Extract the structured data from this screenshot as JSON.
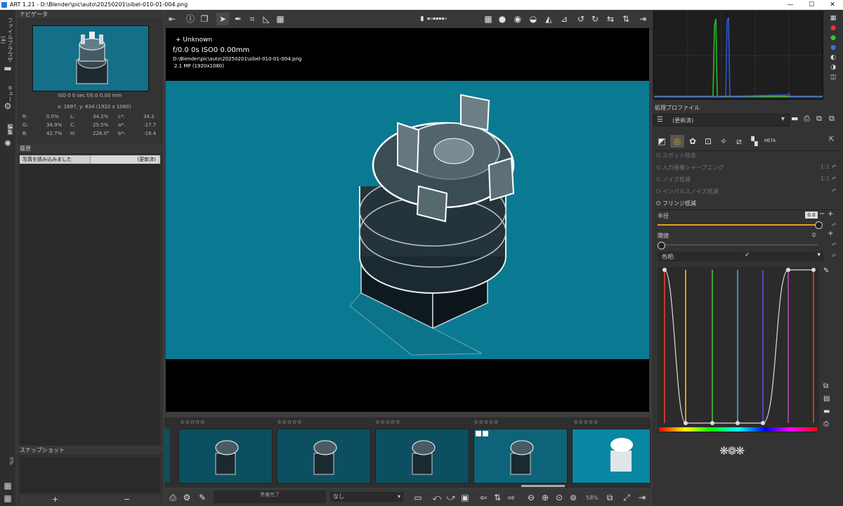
{
  "window": {
    "title": "ART 1.21 - D:\\Blender\\pic\\auto\\20250201\\sibel-010-01-004.png",
    "minimize": "—",
    "maximize": "☐",
    "close": "✕"
  },
  "vertical_tabs": {
    "file_browser": "ファイルブラウザ (4)",
    "queue": "キュー",
    "edit": "編集"
  },
  "navigator": {
    "header": "ナビゲータ",
    "exif": "ISO 0    0 sec    f/0.0    0.00 mm",
    "coords": "x: 1697, y: 634    (1920 x 1080)",
    "rows": [
      {
        "l1": "R:",
        "v1": "0.0%",
        "l2": "L:",
        "v2": "34.2%",
        "l3": "L*:",
        "v3": "34.2"
      },
      {
        "l1": "G:",
        "v1": "34.9%",
        "l2": "C:",
        "v2": "25.5%",
        "l3": "a*:",
        "v3": "-17.7"
      },
      {
        "l1": "B:",
        "v1": "42.7%",
        "l2": "H:",
        "v2": "226.0°",
        "l3": "b*:",
        "v3": "-18.4"
      }
    ]
  },
  "history": {
    "header": "履歴",
    "item_label": "写真を読み込みました",
    "item_status": "(更新済)"
  },
  "snapshot": {
    "header": "スナップショット",
    "add": "+",
    "remove": "−"
  },
  "overlay": {
    "camera": "+ Unknown",
    "exposure": "f/0.0   0s   ISO0   0.00mm",
    "path": "D:\\Blender\\pic\\auto\\20250201\\sibel-010-01-004.png",
    "megapixels": "2.1 MP (1920x1080)"
  },
  "filmstrip": {
    "stars": "☆☆☆☆☆"
  },
  "bottom": {
    "status": "準備完了",
    "select_value": "なし",
    "zoom": "58%"
  },
  "profile": {
    "header": "処理プロファイル",
    "value": "(更新済)"
  },
  "tools": {
    "spot_removal": "スポット除去",
    "input_sharpening": "入力画像シャープニング",
    "noise_reduction": "ノイズ低減",
    "impulse_noise": "インパルスノイズ低減",
    "fringe": "フリンジ低減",
    "ratio1": "1:1",
    "ratio2": "1:1",
    "radius_label": "半径",
    "radius_value": "0.0",
    "threshold_label": "閾値",
    "threshold_value": "0",
    "hue_label": "色相:",
    "meta": "META"
  },
  "colors": {
    "photo_bg": "#0a7a93",
    "accent": "#e0a020",
    "hist_green": "#27c627",
    "hist_blue": "#2e5bdc"
  }
}
